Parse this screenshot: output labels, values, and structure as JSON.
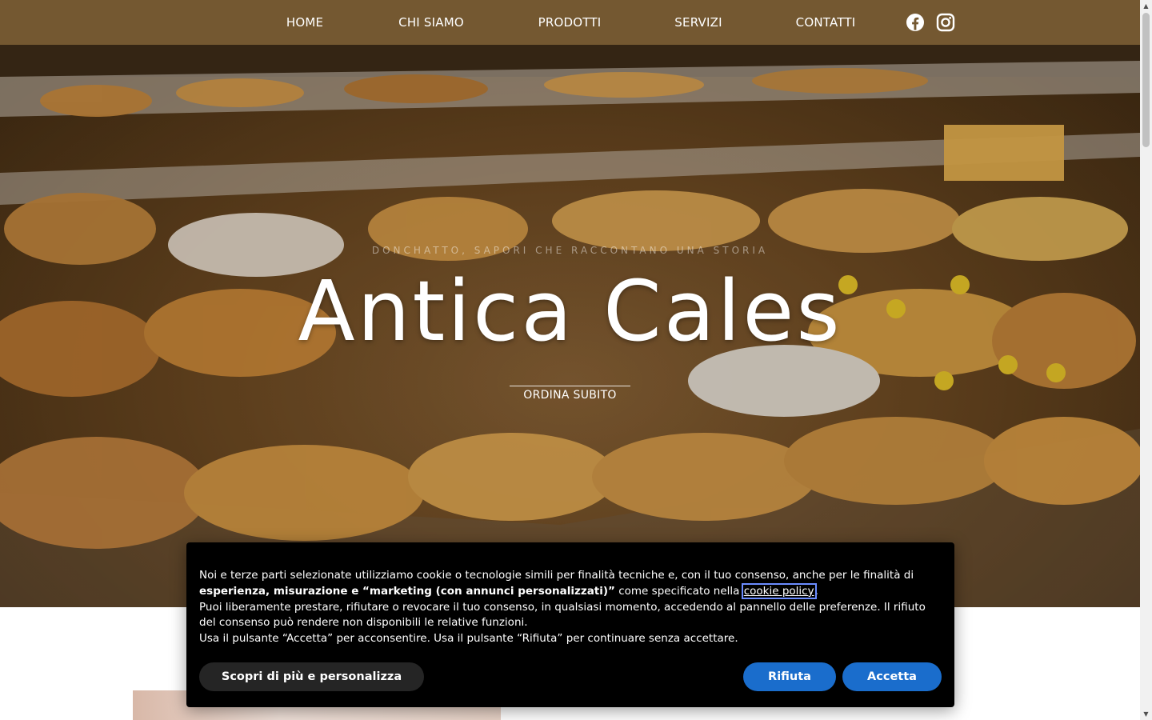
{
  "nav": {
    "items": [
      {
        "label": "HOME"
      },
      {
        "label": "CHI SIAMO"
      },
      {
        "label": "PRODOTTI"
      },
      {
        "label": "SERVIZI"
      },
      {
        "label": "CONTATTI"
      }
    ],
    "social": [
      {
        "icon": "facebook-icon"
      },
      {
        "icon": "instagram-icon"
      }
    ]
  },
  "hero": {
    "tagline": "DONCHATTO, SAPORI CHE RACCONTANO UNA STORIA",
    "title": "Antica Cales",
    "cta": "ORDINA SUBITO"
  },
  "cookie": {
    "line1": "Noi e terze parti selezionate utilizziamo cookie o tecnologie simili per finalità tecniche e, con il tuo consenso, anche per le finalità di",
    "bold": "esperienza, misurazione e “marketing (con annunci personalizzati)”",
    "mid": " come specificato nella ",
    "link": "cookie policy",
    "dot": ".",
    "para2": "Puoi liberamente prestare, rifiutare o revocare il tuo consenso, in qualsiasi momento, accedendo al pannello delle preferenze. Il rifiuto del consenso può rendere non disponibili le relative funzioni.",
    "para3": "Usa il pulsante “Accetta” per acconsentire. Usa il pulsante “Rifiuta” per continuare senza accettare.",
    "btn_customize": "Scopri di più e personalizza",
    "btn_reject": "Rifiuta",
    "btn_accept": "Accetta"
  },
  "colors": {
    "nav_bg": "#745831",
    "button_blue": "#1a6dcc",
    "banner_bg": "#000000"
  }
}
